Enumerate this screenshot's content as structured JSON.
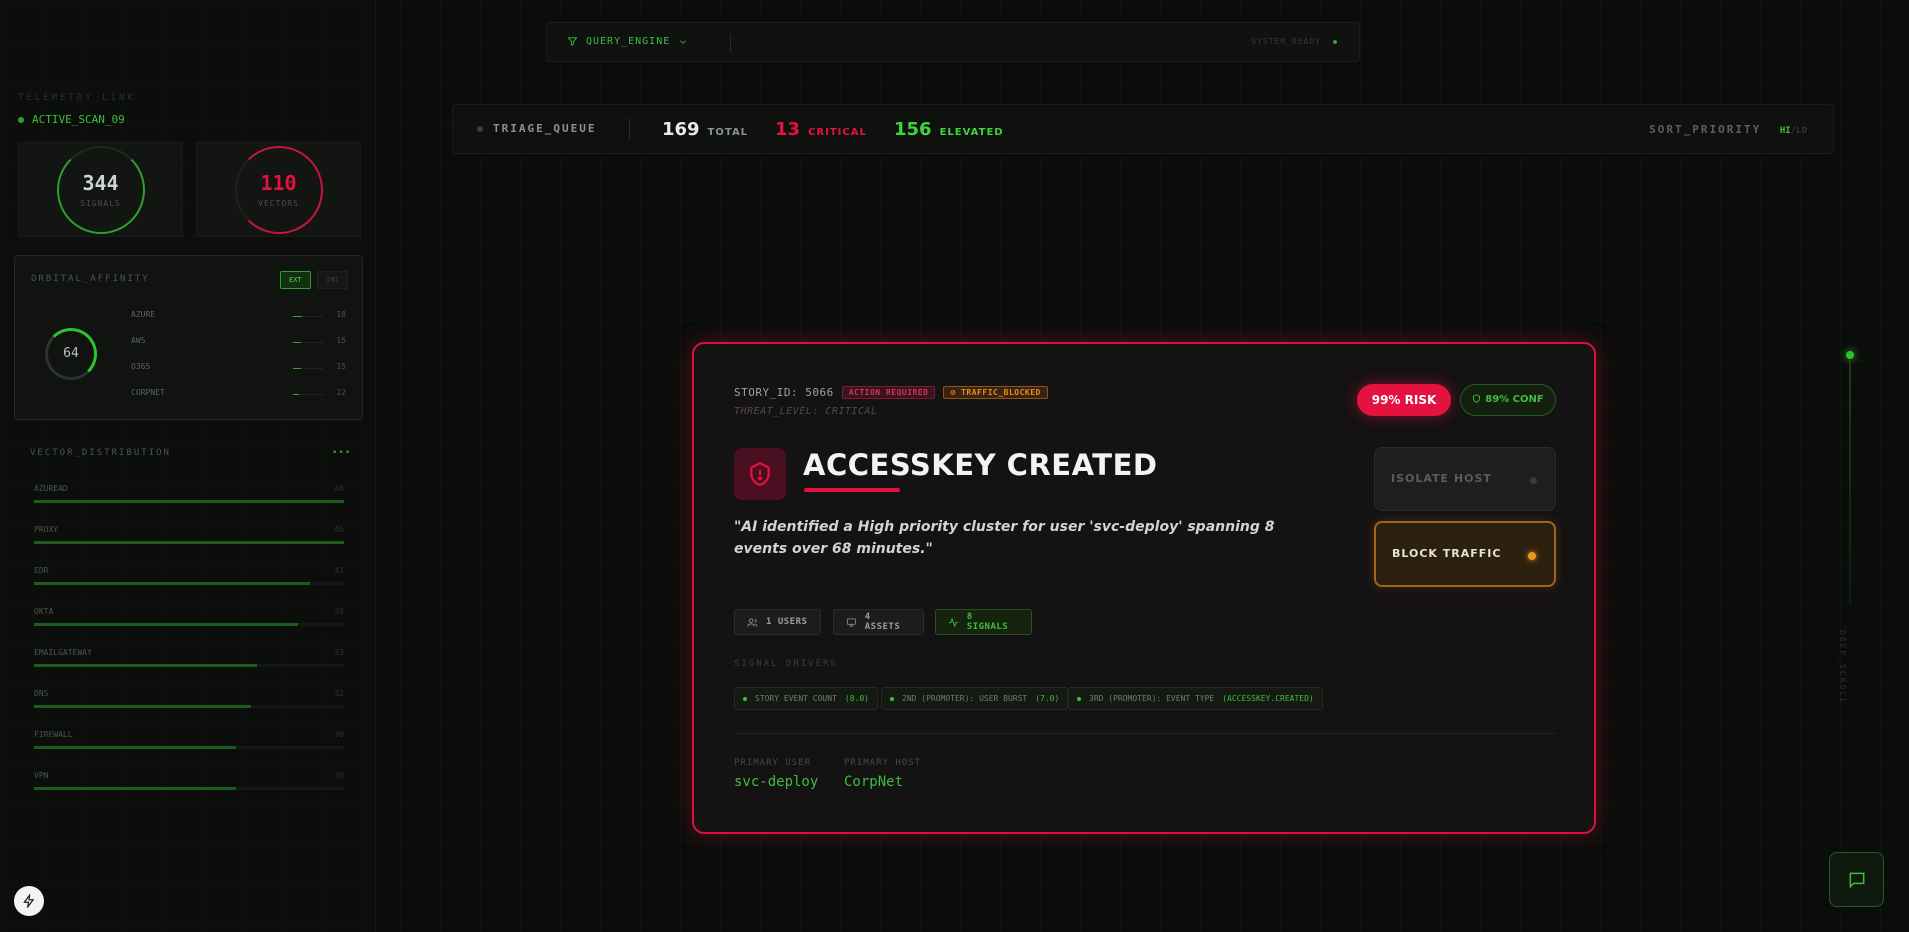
{
  "colors": {
    "accent_green": "#3fbd3f",
    "critical_red": "#e3123f",
    "warning_orange": "#f0961e",
    "background": "#0b0d0b"
  },
  "sidebar": {
    "telemetry_label": "TELEMETRY_LINK",
    "scan_status": "ACTIVE_SCAN_09",
    "stats": [
      {
        "value": "344",
        "label": "SIGNALS",
        "color": "#cfd4cf"
      },
      {
        "value": "110",
        "label": "VECTORS",
        "color": "#e3123f"
      }
    ],
    "orbital": {
      "title": "ORBITAL_AFFINITY",
      "toggle_ext": "EXT",
      "toggle_int": "INT",
      "ring_value": "64",
      "rows": [
        {
          "name": "AZURE",
          "value": "18",
          "fraction": 0.3
        },
        {
          "name": "AWS",
          "value": "15",
          "fraction": 0.25
        },
        {
          "name": "O365",
          "value": "15",
          "fraction": 0.25
        },
        {
          "name": "CORPNET",
          "value": "12",
          "fraction": 0.2
        }
      ]
    },
    "vector_distribution": {
      "title": "VECTOR_DISTRIBUTION",
      "menu_icon": "dots-icon",
      "rows": [
        {
          "name": "AZUREAD",
          "value": "46",
          "fraction": 1.0
        },
        {
          "name": "PROXY",
          "value": "46",
          "fraction": 1.0
        },
        {
          "name": "EDR",
          "value": "41",
          "fraction": 0.89
        },
        {
          "name": "OKTA",
          "value": "39",
          "fraction": 0.85
        },
        {
          "name": "EMAILGATEWAY",
          "value": "33",
          "fraction": 0.72
        },
        {
          "name": "DNS",
          "value": "32",
          "fraction": 0.7
        },
        {
          "name": "FIREWALL",
          "value": "30",
          "fraction": 0.65
        },
        {
          "name": "VPN",
          "value": "30",
          "fraction": 0.65
        }
      ]
    }
  },
  "header": {
    "query_engine": "QUERY_ENGINE",
    "system_status": "SYSTEM_READY"
  },
  "triage": {
    "label": "TRIAGE_QUEUE",
    "total": {
      "value": "169",
      "label": "TOTAL",
      "color": "#e8ece8"
    },
    "critical": {
      "value": "13",
      "label": "CRITICAL",
      "color": "#e3123f"
    },
    "elevated": {
      "value": "156",
      "label": "ELEVATED",
      "color": "#3fd43f"
    },
    "sort_label": "SORT_PRIORITY",
    "sort_hi": "HI",
    "sort_lo": "LO"
  },
  "story": {
    "id_text": "STORY_ID: 5066",
    "badge_action": "ACTION REQUIRED",
    "badge_traffic": "TRAFFIC_BLOCKED",
    "threat_level": "THREAT_LEVEL: CRITICAL",
    "risk": "99% RISK",
    "confidence": "89% CONF",
    "title": "ACCESSKEY CREATED",
    "summary": "\"AI identified a High priority cluster for user 'svc-deploy' spanning 8 events over 68 minutes.\"",
    "actions": {
      "isolate": "ISOLATE HOST",
      "block": "BLOCK TRAFFIC"
    },
    "chips": {
      "users": "1 USERS",
      "assets": "4 ASSETS",
      "signals": "8 SIGNALS"
    },
    "drivers_title": "SIGNAL DRIVERS",
    "drivers": [
      {
        "label": "STORY EVENT COUNT",
        "value": "(8.0)"
      },
      {
        "label": "2ND (PROMOTER): USER BURST",
        "value": "(7.0)"
      },
      {
        "label": "3RD (PROMOTER): EVENT TYPE",
        "value": "(ACCESSKEY.CREATED)"
      }
    ],
    "primary_user_label": "PRIMARY USER",
    "primary_user": "svc-deploy",
    "primary_host_label": "PRIMARY HOST",
    "primary_host": "CorpNet"
  },
  "rail": {
    "label": "DEEP_SCROLL"
  }
}
